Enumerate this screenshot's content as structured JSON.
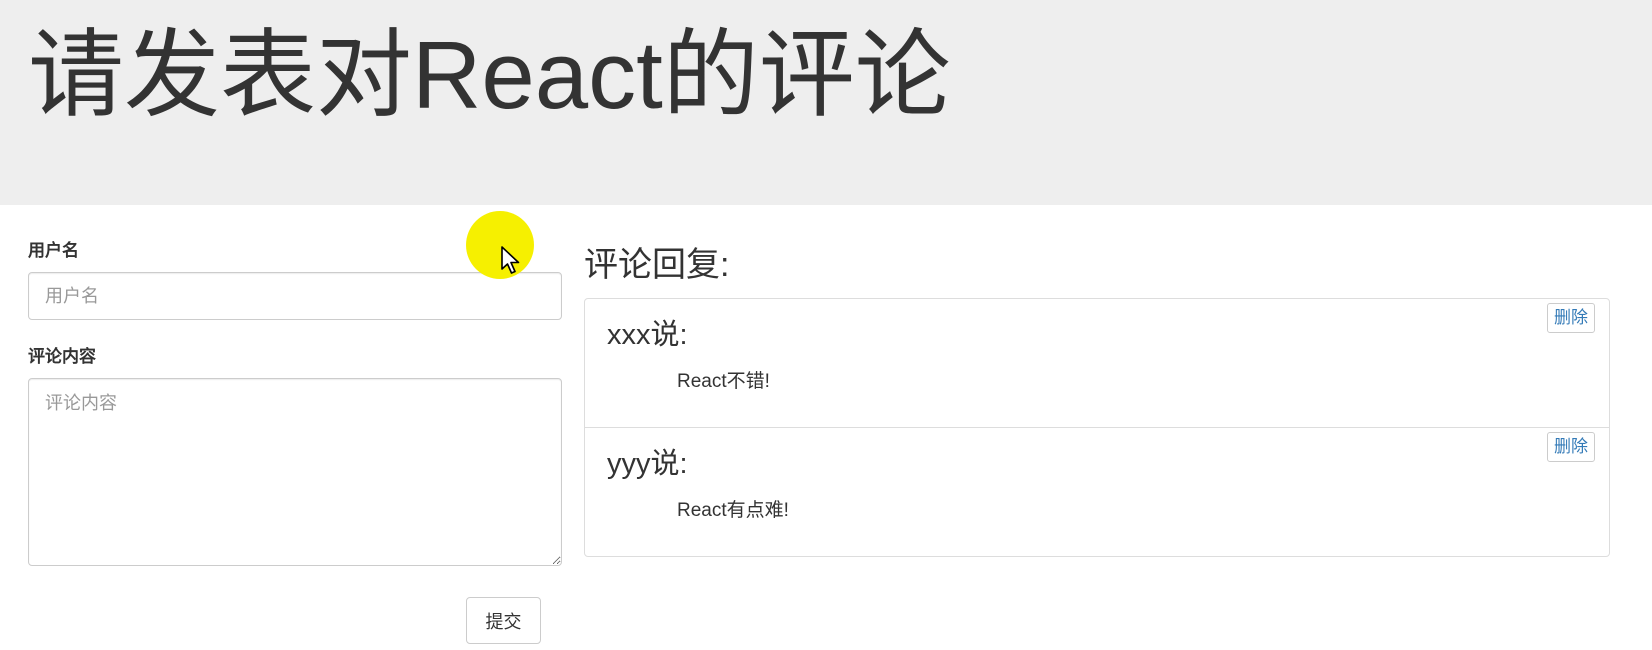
{
  "header": {
    "title": "请发表对React的评论"
  },
  "form": {
    "username_label": "用户名",
    "username_placeholder": "用户名",
    "username_value": "",
    "content_label": "评论内容",
    "content_placeholder": "评论内容",
    "content_value": "",
    "submit_label": "提交"
  },
  "replies": {
    "heading": "评论回复:",
    "items": [
      {
        "user": "xxx说:",
        "content": "React不错!",
        "delete_label": "删除"
      },
      {
        "user": "yyy说:",
        "content": "React有点难!",
        "delete_label": "删除"
      }
    ]
  },
  "colors": {
    "header_bg": "#eeeeee",
    "link_blue": "#337ab7",
    "cursor_highlight": "#f6f000"
  },
  "icons": {
    "cursor": "mouse-pointer-icon"
  }
}
